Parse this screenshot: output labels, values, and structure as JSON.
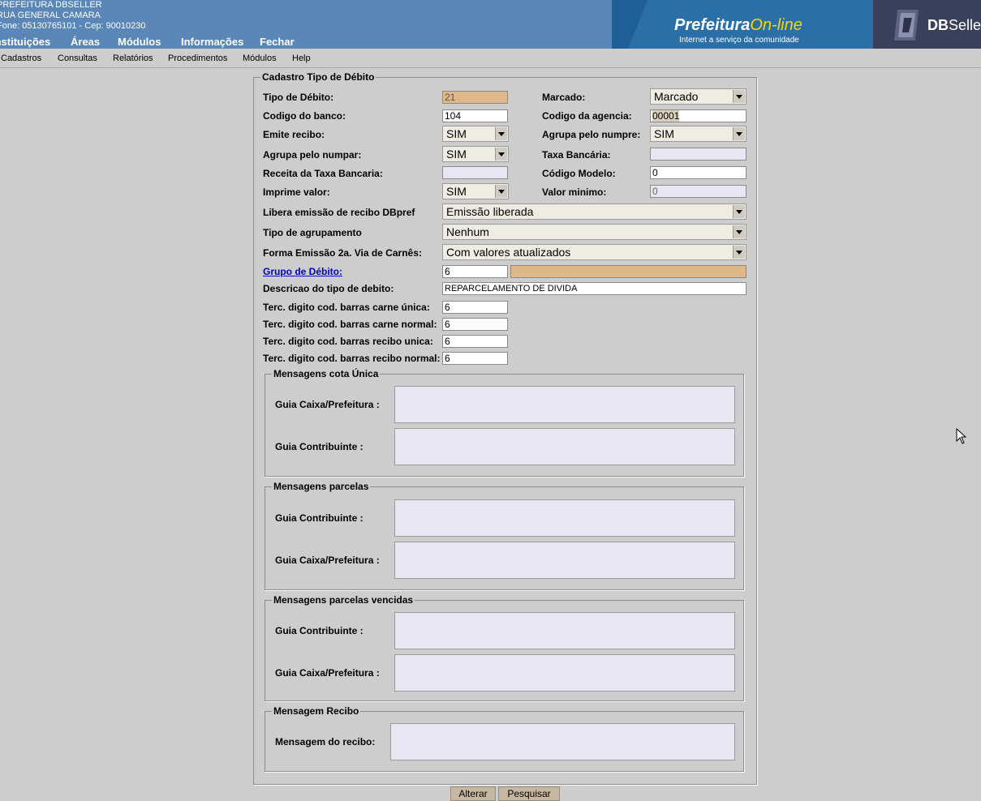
{
  "header": {
    "info_line1": "PREFEITURA DBSELLER",
    "info_line2": "RUA GENERAL CAMARA",
    "info_line3": "Fone: 05130765101  -  Cep: 90010230",
    "menu": [
      "Instituições",
      "Áreas",
      "Módulos",
      "Informações",
      "Fechar"
    ],
    "brand_title": "Prefeitura",
    "brand_title_accent": "On-line",
    "brand_subtitle": "Internet a serviço da comunidade",
    "vendor_bold": "DB",
    "vendor_rest": "Seller",
    "colors": {
      "header_bg": "#5a87b7",
      "brand_accent": "#f5d800"
    }
  },
  "submenu": [
    "Cadastros",
    "Consultas",
    "Relatórios",
    "Procedimentos",
    "Módulos",
    "Help"
  ],
  "form": {
    "legend": "Cadastro Tipo de Débito",
    "tipo_debito": {
      "label": "Tipo de Débito:",
      "value": "21"
    },
    "marcado": {
      "label": "Marcado:",
      "value": "Marcado"
    },
    "codigo_banco": {
      "label": "Codigo do banco:",
      "value": "104"
    },
    "codigo_agencia": {
      "label": "Codigo da agencia:",
      "value": "00001"
    },
    "emite_recibo": {
      "label": "Emite recibo:",
      "value": "SIM"
    },
    "agrupa_numpre": {
      "label": "Agrupa pelo numpre:",
      "value": "SIM"
    },
    "agrupa_numpar": {
      "label": "Agrupa pelo numpar:",
      "value": "SIM"
    },
    "taxa_bancaria": {
      "label": "Taxa Bancária:",
      "value": ""
    },
    "receita_taxa": {
      "label": "Receita da Taxa Bancaria:",
      "value": ""
    },
    "codigo_modelo": {
      "label": "Código Modelo:",
      "value": "0"
    },
    "imprime_valor": {
      "label": "Imprime valor:",
      "value": "SIM"
    },
    "valor_minimo": {
      "label": "Valor minimo:",
      "value": "0"
    },
    "libera_emissao": {
      "label": "Libera emissão de recibo DBpref",
      "value": "Emissão liberada"
    },
    "tipo_agrupamento": {
      "label": "Tipo de agrupamento",
      "value": "Nenhum"
    },
    "forma_emissao": {
      "label": "Forma Emissão 2a. Via de Carnês:",
      "value": "Com valores atualizados"
    },
    "grupo_debito": {
      "label": "Grupo de Débito:",
      "value": "6",
      "desc": ""
    },
    "descricao": {
      "label": "Descricao do tipo de debito:",
      "value": "REPARCELAMENTO DE DIVIDA"
    },
    "terc_carne_unica": {
      "label": "Terc. digito cod. barras carne única:",
      "value": "6"
    },
    "terc_carne_normal": {
      "label": "Terc. digito cod. barras carne normal:",
      "value": "6"
    },
    "terc_recibo_unica": {
      "label": "Terc. digito cod. barras recibo unica:",
      "value": "6"
    },
    "terc_recibo_normal": {
      "label": "Terc. digito cod. barras recibo normal:",
      "value": "6"
    }
  },
  "msg_cota_unica": {
    "legend": "Mensagens cota Única",
    "label1": "Guia Caixa/Prefeitura :",
    "label2": "Guia Contribuinte :"
  },
  "msg_parcelas": {
    "legend": "Mensagens parcelas",
    "label1": "Guia Contribuinte :",
    "label2": "Guia Caixa/Prefeitura :"
  },
  "msg_vencidas": {
    "legend": "Mensagens parcelas vencidas",
    "label1": "Guia Contribuinte :",
    "label2": "Guia Caixa/Prefeitura :"
  },
  "msg_recibo": {
    "legend": "Mensagem Recibo",
    "label1": "Mensagem do recibo:"
  },
  "buttons": {
    "alterar": "Alterar",
    "pesquisar": "Pesquisar"
  }
}
